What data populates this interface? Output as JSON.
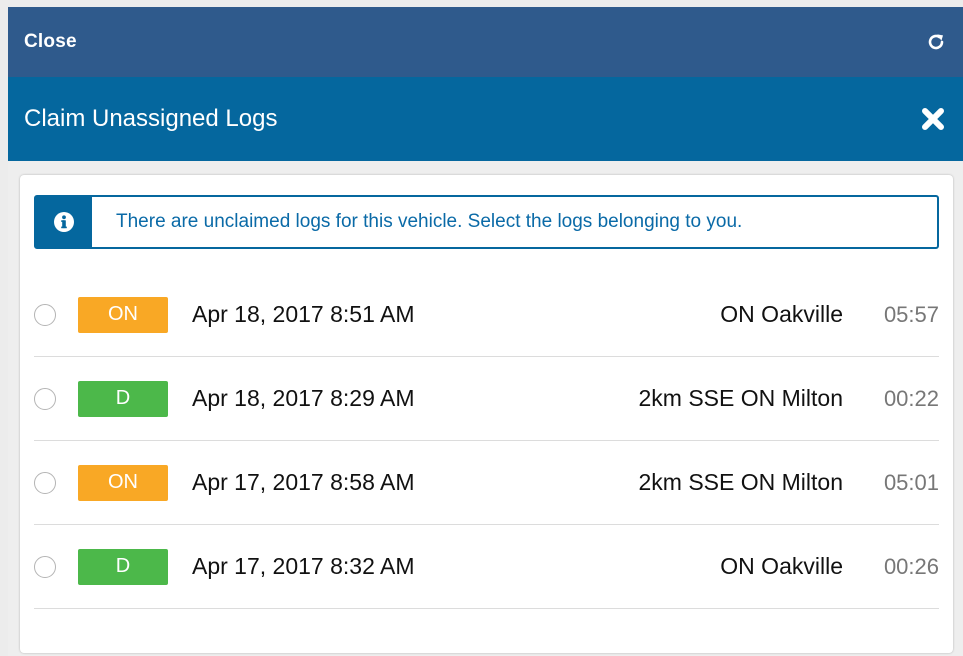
{
  "topbar": {
    "close_label": "Close",
    "refresh_icon": "refresh-icon"
  },
  "titlebar": {
    "title": "Claim Unassigned Logs",
    "close_icon": "close-x-icon"
  },
  "info": {
    "icon": "info-icon",
    "message": "There are unclaimed logs for this vehicle. Select the logs belonging to you."
  },
  "colors": {
    "topbar": "#2f5a8c",
    "titlebar": "#05679e",
    "status_on": "#f9a825",
    "status_d": "#4cb84a",
    "info_text": "#0a6aa7"
  },
  "logs": [
    {
      "status": "ON",
      "date": "Apr 18, 2017 8:51 AM",
      "location": "ON Oakville",
      "duration": "05:57"
    },
    {
      "status": "D",
      "date": "Apr 18, 2017 8:29 AM",
      "location": "2km SSE ON Milton",
      "duration": "00:22"
    },
    {
      "status": "ON",
      "date": "Apr 17, 2017 8:58 AM",
      "location": "2km SSE ON Milton",
      "duration": "05:01"
    },
    {
      "status": "D",
      "date": "Apr 17, 2017 8:32 AM",
      "location": "ON Oakville",
      "duration": "00:26"
    }
  ]
}
